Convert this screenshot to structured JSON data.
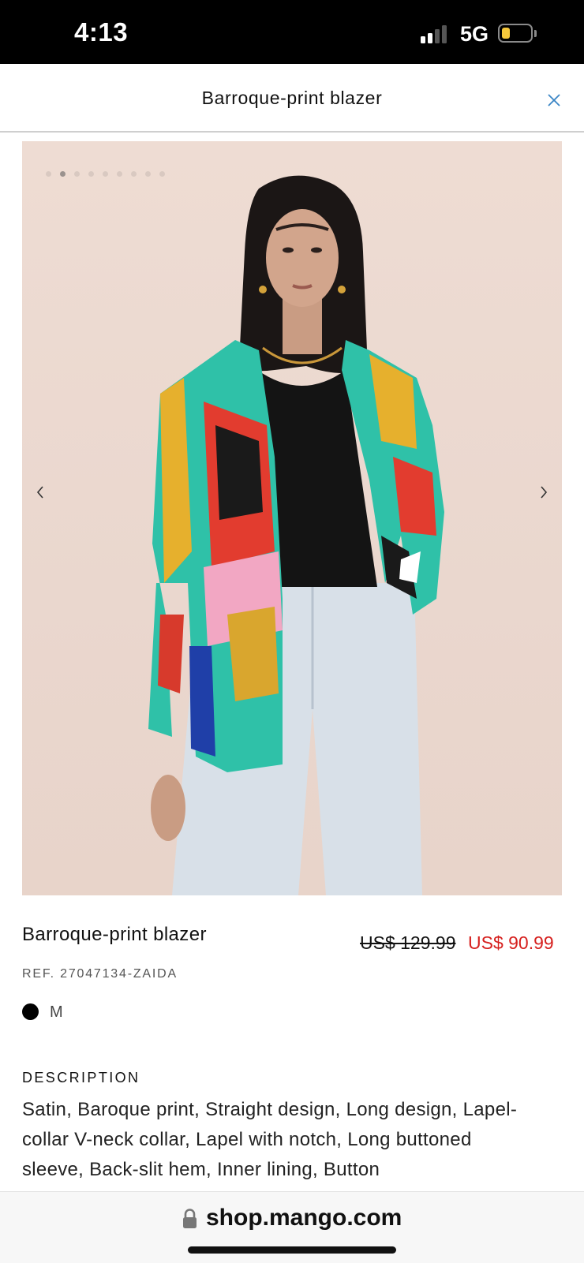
{
  "status_bar": {
    "time": "4:13",
    "network": "5G",
    "battery_color": "#f4c73b"
  },
  "header": {
    "title": "Barroque-print blazer",
    "close_icon": "close-icon",
    "accent_color": "#3b86c6"
  },
  "gallery": {
    "image_alt": "Model wearing multicolor baroque-print blazer with black top and light-wash jeans",
    "total_images": 9,
    "active_index": 1,
    "prev_icon": "chevron-left-icon",
    "next_icon": "chevron-right-icon"
  },
  "product": {
    "name": "Barroque-print blazer",
    "price_original": "US$ 129.99",
    "price_sale": "US$ 90.99",
    "sale_color": "#d6201e",
    "ref": "REF. 27047134-ZAIDA",
    "color_swatch": "#000000",
    "size": "M"
  },
  "description": {
    "heading": "DESCRIPTION",
    "text": "Satin, Baroque print, Straight design, Long design, Lapel-collar V-neck collar, Lapel with notch, Long buttoned sleeve, Back-slit hem, Inner lining, Button"
  },
  "browser": {
    "url": "shop.mango.com",
    "lock_icon": "lock-icon"
  }
}
